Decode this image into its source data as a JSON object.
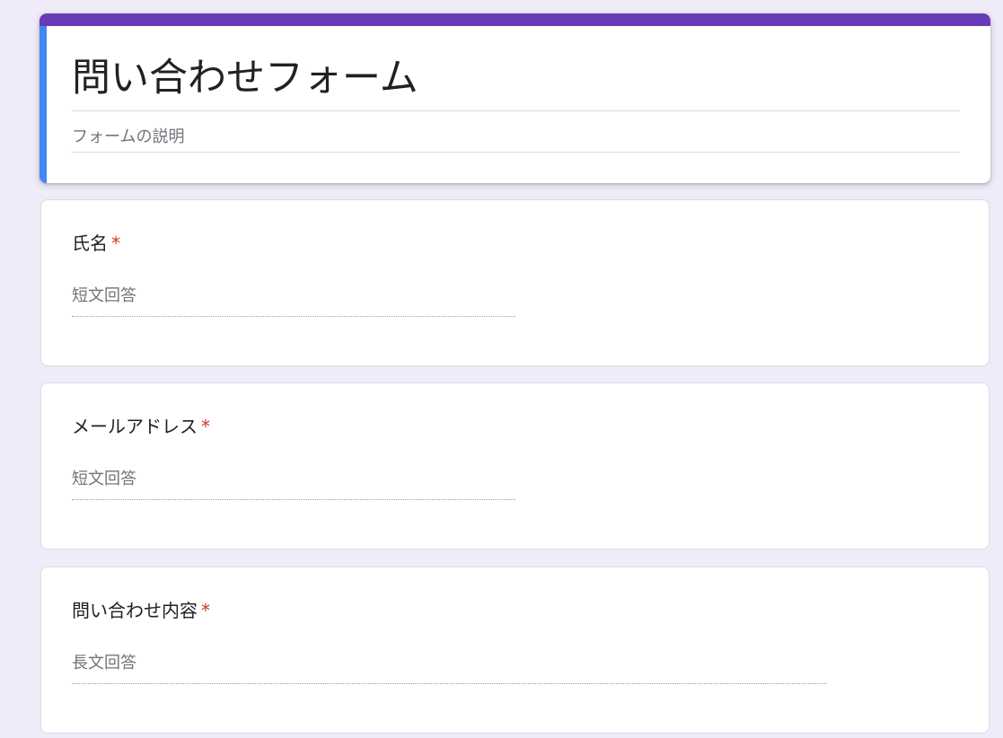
{
  "form": {
    "title": "問い合わせフォーム",
    "description_placeholder": "フォームの説明",
    "theme_color": "#673ab7",
    "active_accent_color": "#4285f4",
    "background_color": "#f0ebf8",
    "required_color": "#d93025"
  },
  "questions": [
    {
      "label": "氏名",
      "required_mark": "*",
      "answer_type_placeholder": "短文回答"
    },
    {
      "label": "メールアドレス",
      "required_mark": "*",
      "answer_type_placeholder": "短文回答"
    },
    {
      "label": "問い合わせ内容",
      "required_mark": "*",
      "answer_type_placeholder": "長文回答"
    }
  ]
}
